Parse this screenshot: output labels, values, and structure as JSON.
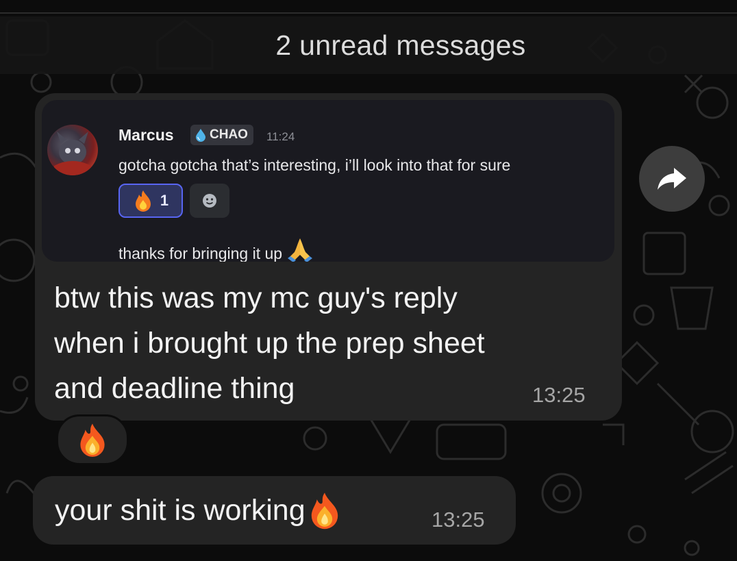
{
  "unread_banner": {
    "text": "2 unread messages"
  },
  "message_1": {
    "embedded_screenshot": {
      "author": "Marcus",
      "tag": "CHAO",
      "time": "11:24",
      "line_1": "gotcha gotcha that’s interesting, i’ll look into that for sure",
      "reaction_count": "1",
      "line_2": "thanks for bringing it up"
    },
    "caption_lines": [
      "btw this was my mc guy's reply",
      "when i brought up the prep sheet",
      "and deadline thing"
    ],
    "time": "13:25"
  },
  "message_2": {
    "text": "your shit is working",
    "time": "13:25"
  },
  "icons": {
    "forward": "share-arrow-icon",
    "reaction": "fire-emoji-icon",
    "add_reaction": "smiley-icon",
    "tag": "water-drop-icon",
    "hands": "folded-hands-emoji-icon"
  },
  "colors": {
    "bubble": "#242424",
    "background": "#0c0c0c",
    "discord_bg": "#1a1a20",
    "reaction_accent": "#5865f2"
  }
}
